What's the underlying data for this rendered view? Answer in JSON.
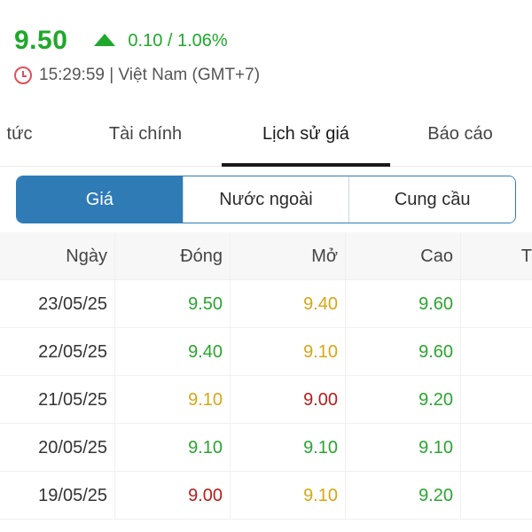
{
  "quote": {
    "price": "9.50",
    "change": "0.10 / 1.06%",
    "time": "15:29:59 | Việt Nam (GMT+7)"
  },
  "tabs": [
    {
      "label": "tức",
      "active": false
    },
    {
      "label": "Tài chính",
      "active": false
    },
    {
      "label": "Lịch sử giá",
      "active": true
    },
    {
      "label": "Báo cáo",
      "active": false
    }
  ],
  "segments": [
    {
      "label": "Giá",
      "active": true
    },
    {
      "label": "Nước ngoài",
      "active": false
    },
    {
      "label": "Cung cầu",
      "active": false
    }
  ],
  "table": {
    "headers": [
      "Ngày",
      "Đóng",
      "Mở",
      "Cao",
      "T"
    ],
    "rows": [
      {
        "date": "23/05/25",
        "close": "9.50",
        "open": "9.40",
        "high": "9.60"
      },
      {
        "date": "22/05/25",
        "close": "9.40",
        "open": "9.10",
        "high": "9.60"
      },
      {
        "date": "21/05/25",
        "close": "9.10",
        "open": "9.00",
        "high": "9.20"
      },
      {
        "date": "20/05/25",
        "close": "9.10",
        "open": "9.10",
        "high": "9.10"
      },
      {
        "date": "19/05/25",
        "close": "9.00",
        "open": "9.10",
        "high": "9.20"
      }
    ]
  },
  "colors": {
    "up": "#2aa52f",
    "reference": "#d9a515",
    "down": "#b51d1d",
    "accent": "#2e7bb6"
  },
  "icons": {
    "change_indicator": "triangle-up-icon",
    "time": "clock-icon"
  }
}
